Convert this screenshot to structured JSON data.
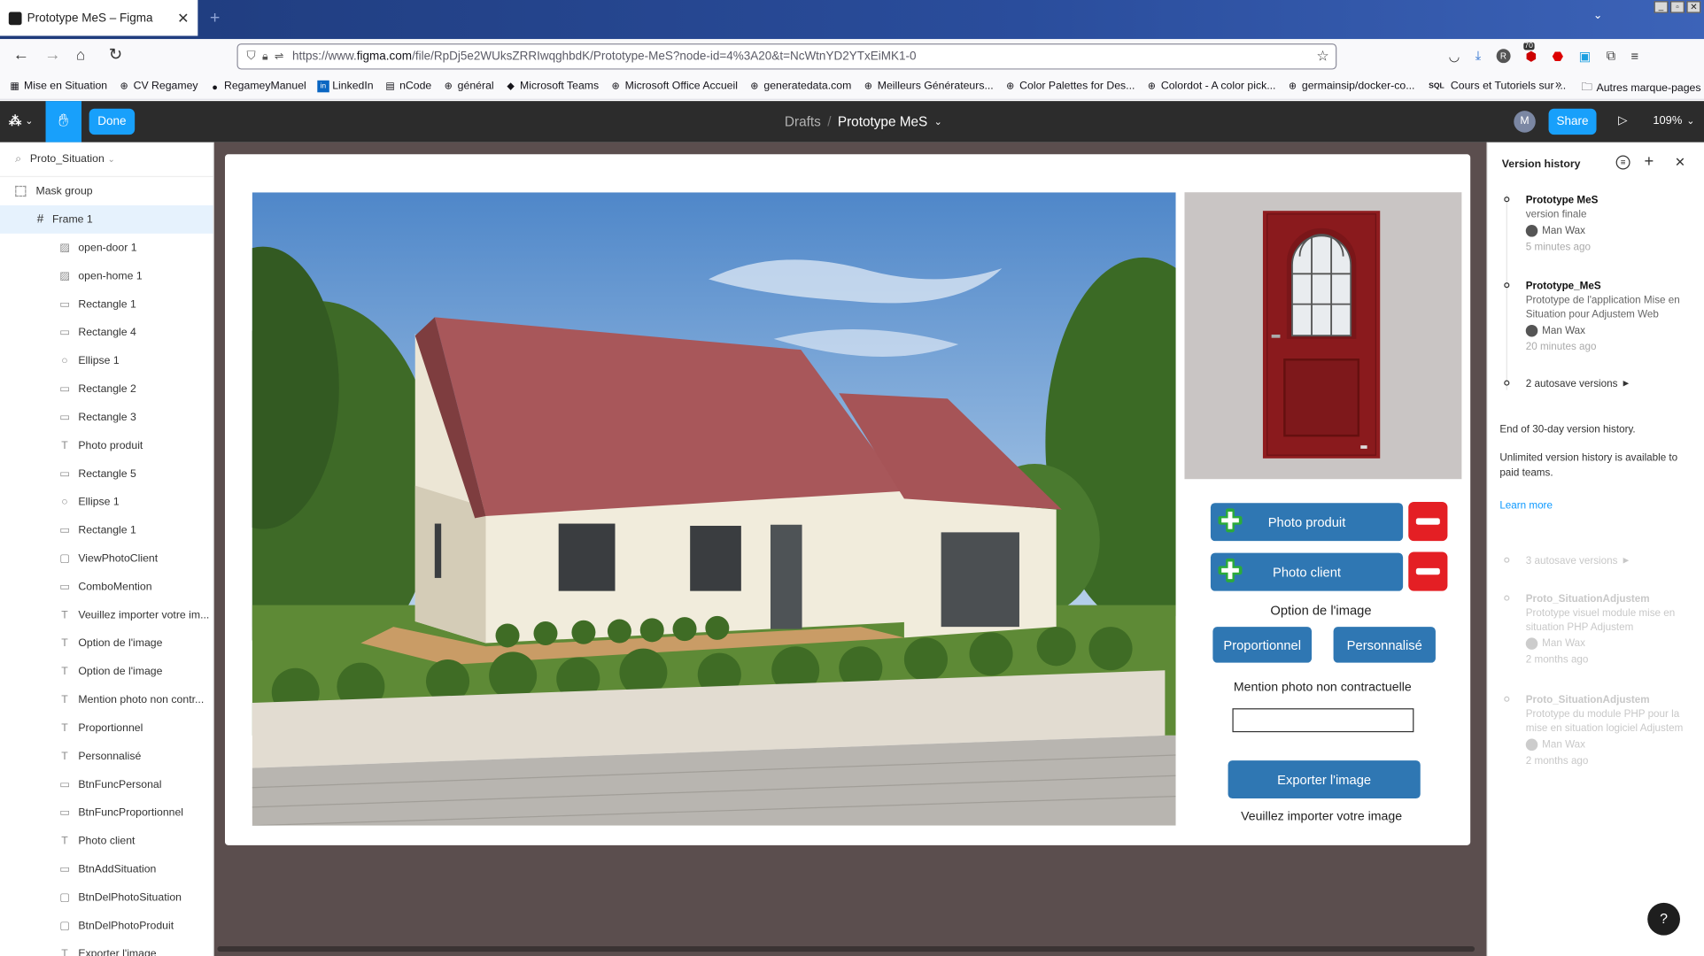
{
  "browser": {
    "tab_title": "Prototype MeS – Figma",
    "url_prefix": "https://www.",
    "url_domain": "figma.com",
    "url_path": "/file/RpDj5e2WUksZRRIwqghbdK/Prototype-MeS?node-id=4%3A20&t=NcWtnYD2YTxEiMK1-0",
    "badge_count": "70",
    "bookmarks": [
      "Mise en Situation",
      "CV Regamey",
      "RegameyManuel",
      "LinkedIn",
      "nCode",
      "général",
      "Microsoft Teams",
      "Microsoft Office Accueil",
      "generatedata.com",
      "Meilleurs Générateurs...",
      "Color Palettes for Des...",
      "Colordot - A color pick...",
      "germainsip/docker-co...",
      "Cours et Tutoriels sur ..."
    ],
    "other_bookmarks": "Autres marque-pages"
  },
  "figma": {
    "done_label": "Done",
    "breadcrumb_parent": "Drafts",
    "breadcrumb_sep": "/",
    "file_name": "Prototype MeS",
    "avatar_letter": "M",
    "share_label": "Share",
    "zoom": "109%"
  },
  "layers": {
    "page_name": "Proto_Situation",
    "mask_group": "Mask group",
    "frame": "Frame 1",
    "items": [
      {
        "icon": "image-icon",
        "label": "open-door 1"
      },
      {
        "icon": "image-icon",
        "label": "open-home 1"
      },
      {
        "icon": "rectangle-icon",
        "label": "Rectangle 1"
      },
      {
        "icon": "rectangle-icon",
        "label": "Rectangle 4"
      },
      {
        "icon": "ellipse-icon",
        "label": "Ellipse 1"
      },
      {
        "icon": "rectangle-icon",
        "label": "Rectangle 2"
      },
      {
        "icon": "rectangle-icon",
        "label": "Rectangle 3"
      },
      {
        "icon": "text-icon",
        "label": "Photo produit"
      },
      {
        "icon": "rectangle-icon",
        "label": "Rectangle 5"
      },
      {
        "icon": "ellipse-icon",
        "label": "Ellipse 1"
      },
      {
        "icon": "rectangle-icon",
        "label": "Rectangle 1"
      },
      {
        "icon": "frame-icon",
        "label": "ViewPhotoClient"
      },
      {
        "icon": "rectangle-icon",
        "label": "ComboMention"
      },
      {
        "icon": "text-icon",
        "label": "Veuillez importer votre im..."
      },
      {
        "icon": "text-icon",
        "label": "Option de l'image"
      },
      {
        "icon": "text-icon",
        "label": "Option de l'image"
      },
      {
        "icon": "text-icon",
        "label": "Mention photo non contr..."
      },
      {
        "icon": "text-icon",
        "label": "Proportionnel"
      },
      {
        "icon": "text-icon",
        "label": "Personnalisé"
      },
      {
        "icon": "rectangle-icon",
        "label": "BtnFuncPersonal"
      },
      {
        "icon": "rectangle-icon",
        "label": "BtnFuncProportionnel"
      },
      {
        "icon": "text-icon",
        "label": "Photo client"
      },
      {
        "icon": "rectangle-icon",
        "label": "BtnAddSituation"
      },
      {
        "icon": "frame-icon",
        "label": "BtnDelPhotoSituation"
      },
      {
        "icon": "frame-icon",
        "label": "BtnDelPhotoProduit"
      },
      {
        "icon": "text-icon",
        "label": "Exporter l'image"
      }
    ]
  },
  "prototype": {
    "photo_produit": "Photo produit",
    "photo_client": "Photo client",
    "option_title": "Option de l'image",
    "proportionnel": "Proportionnel",
    "personnalise": "Personnalisé",
    "mention_label": "Mention photo non contractuelle",
    "mention_value": "",
    "export_label": "Exporter l'image",
    "import_hint": "Veuillez importer votre image",
    "colors": {
      "blue_button": "#2f77b3",
      "red_button": "#e41f24",
      "green_plus": "#2bab3b",
      "door_red": "#8f1c1f"
    }
  },
  "history": {
    "title": "Version history",
    "versions": [
      {
        "name": "Prototype MeS",
        "desc": "version finale",
        "author": "Man Wax",
        "time": "5 minutes ago"
      },
      {
        "name": "Prototype_MeS",
        "desc": "Prototype de l'application Mise en Situation pour Adjustem Web",
        "author": "Man Wax",
        "time": "20 minutes ago"
      }
    ],
    "autosave": "2 autosave versions",
    "end_note": "End of 30-day version history.",
    "unlimited_note": "Unlimited version history is available to paid teams.",
    "learn_more": "Learn more",
    "old_autosave": "3 autosave versions",
    "old_versions": [
      {
        "name": "Proto_SituationAdjustem",
        "desc": "Prototype visuel module mise en situation PHP Adjustem",
        "author": "Man Wax",
        "time": "2 months ago"
      },
      {
        "name": "Proto_SituationAdjustem",
        "desc": "Prototype du module PHP pour la mise en situation logiciel Adjustem",
        "author": "Man Wax",
        "time": "2 months ago"
      }
    ],
    "help": "?"
  }
}
